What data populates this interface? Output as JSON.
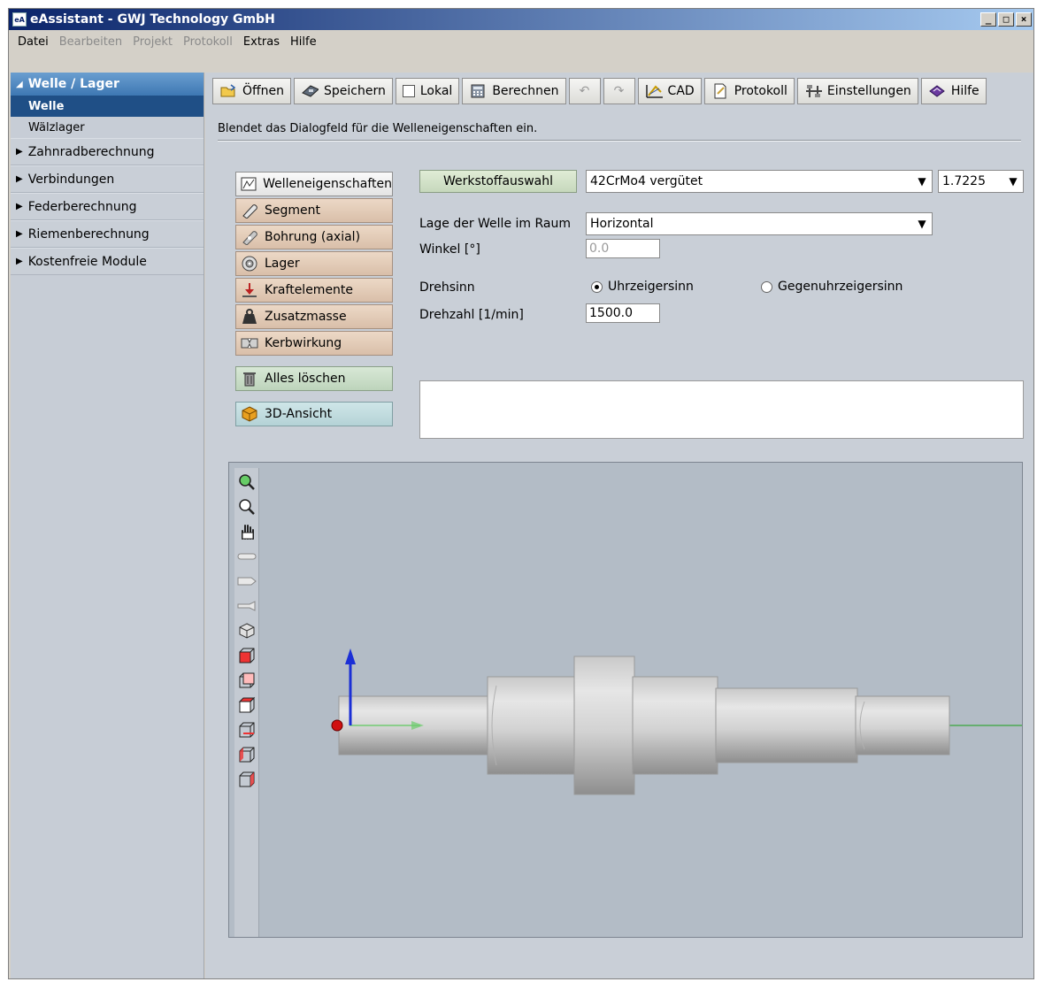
{
  "window": {
    "title": "eAssistant - GWJ Technology GmbH",
    "app_icon": "eA"
  },
  "menu": [
    {
      "label": "Datei",
      "disabled": false
    },
    {
      "label": "Bearbeiten",
      "disabled": true
    },
    {
      "label": "Projekt",
      "disabled": true
    },
    {
      "label": "Protokoll",
      "disabled": true
    },
    {
      "label": "Extras",
      "disabled": false
    },
    {
      "label": "Hilfe",
      "disabled": false
    }
  ],
  "sidebar": {
    "group": "Welle / Lager",
    "items": [
      "Welle",
      "Wälzlager"
    ],
    "groups": [
      "Zahnradberechnung",
      "Verbindungen",
      "Federberechnung",
      "Riemenberechnung",
      "Kostenfreie Module"
    ]
  },
  "toolbar": {
    "open": "Öffnen",
    "save": "Speichern",
    "local": "Lokal",
    "calculate": "Berechnen",
    "cad": "CAD",
    "protocol": "Protokoll",
    "settings": "Einstellungen",
    "help": "Hilfe"
  },
  "info_text": "Blendet das Dialogfeld für die Welleneigenschaften ein.",
  "side_buttons": {
    "shaft_props": "Welleneigenschaften",
    "segment": "Segment",
    "bore": "Bohrung (axial)",
    "bearing": "Lager",
    "force": "Kraftelemente",
    "mass": "Zusatzmasse",
    "notch": "Kerbwirkung",
    "clear": "Alles löschen",
    "view3d": "3D-Ansicht"
  },
  "form": {
    "material_button": "Werkstoffauswahl",
    "material": "42CrMo4 vergütet",
    "material_no": "1.7225",
    "position_label": "Lage der Welle im Raum",
    "position": "Horizontal",
    "angle_label": "Winkel [°]",
    "angle": "0.0",
    "direction_label": "Drehsinn",
    "direction_cw": "Uhrzeigersinn",
    "direction_ccw": "Gegenuhrzeigersinn",
    "speed_label": "Drehzahl [1/min]",
    "speed": "1500.0"
  }
}
